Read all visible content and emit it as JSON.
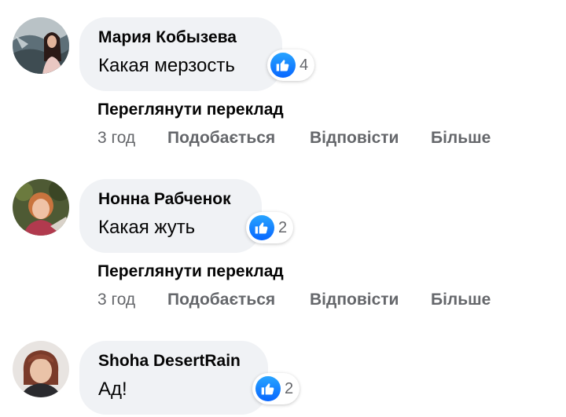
{
  "comments": [
    {
      "author": "Мария Кобызева",
      "text": "Какая мерзость",
      "reaction_icon": "like-icon",
      "reaction_count": "4",
      "translate_label": "Переглянути переклад",
      "time": "3 год",
      "like_label": "Подобається",
      "reply_label": "Відповісти",
      "more_label": "Більше"
    },
    {
      "author": "Нонна Рабченок",
      "text": "Какая жуть",
      "reaction_icon": "like-icon",
      "reaction_count": "2",
      "translate_label": "Переглянути переклад",
      "time": "3 год",
      "like_label": "Подобається",
      "reply_label": "Відповісти",
      "more_label": "Більше"
    },
    {
      "author": "Shoha DesertRain",
      "text": "Ад!",
      "reaction_icon": "like-icon",
      "reaction_count": "2"
    }
  ],
  "colors": {
    "bubble": "#f0f2f5",
    "like_blue": "#0866ff",
    "secondary_text": "#65676b",
    "primary_text": "#050505"
  }
}
